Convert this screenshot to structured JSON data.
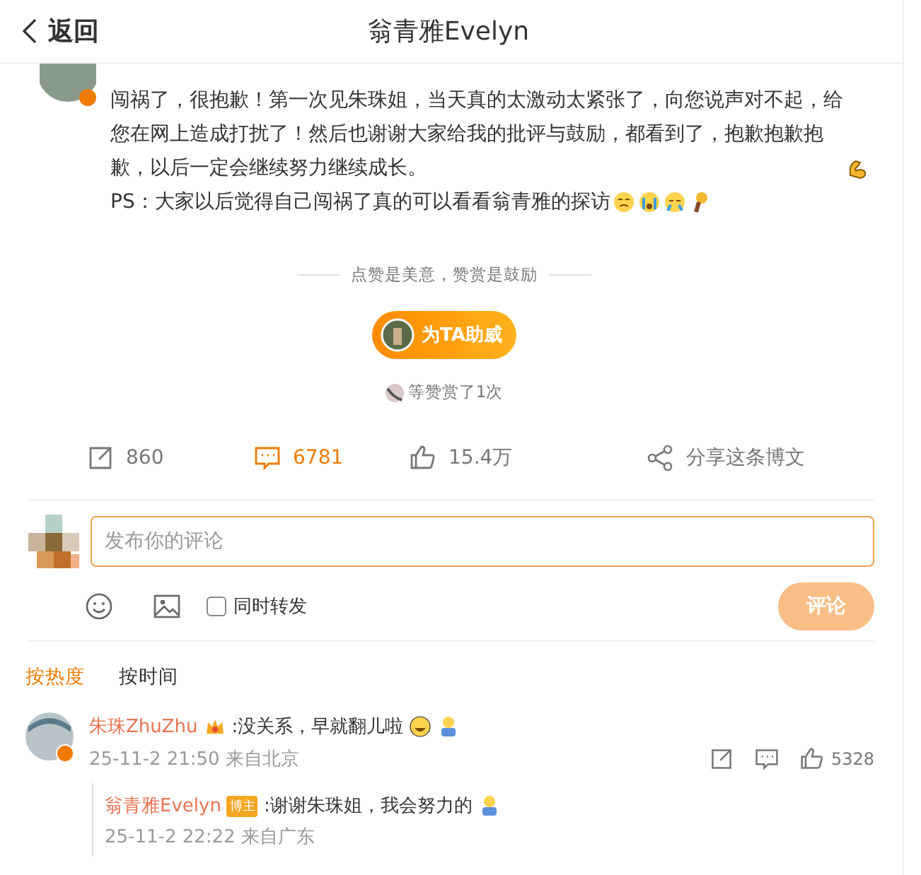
{
  "header": {
    "back": "返回",
    "title": "翁青雅Evelyn"
  },
  "post": {
    "paragraphs": [
      {
        "text": "闯祸了，很抱歉！第一次见朱珠姐，当天真的太激动太紧张了，向您说声对不起，给您在网上造成打扰了！然后也谢谢大家给我的批评与鼓励，都看到了，抱歉抱歉抱歉，以后一定会继续努力继续成长。"
      },
      {
        "text": "PS：大家以后觉得自己闯祸了真的可以看看翁青雅的探访"
      }
    ]
  },
  "reward": {
    "slogan": "点赞是美意，赞赏是鼓励",
    "button": "为TA助威",
    "summary": "等赞赏了1次"
  },
  "actions": [
    {
      "kind": "repost",
      "label": "860",
      "selected": false
    },
    {
      "kind": "comment",
      "label": "6781",
      "selected": true
    },
    {
      "kind": "like",
      "label": "15.4万",
      "selected": false
    },
    {
      "kind": "share",
      "label": "分享这条博文",
      "selected": false
    }
  ],
  "composer": {
    "placeholder": "发布你的评论",
    "repost_label": "同时转发",
    "repost_checked": false,
    "submit": "评论",
    "submit_disabled": true
  },
  "sort_tabs": [
    {
      "label": "按热度",
      "selected": true
    },
    {
      "label": "按时间",
      "selected": false
    }
  ],
  "comments": [
    {
      "author": "朱珠ZhuZhu",
      "text": ":没关系，早就翻儿啦",
      "time": "25-11-2 21:50 来自北京",
      "likes": "5328",
      "replies": [
        {
          "author": "翁青雅Evelyn",
          "badge": "博主",
          "text": ":谢谢朱珠姐，我会努力的",
          "time": "25-11-2 22:22 来自广东"
        }
      ]
    }
  ]
}
